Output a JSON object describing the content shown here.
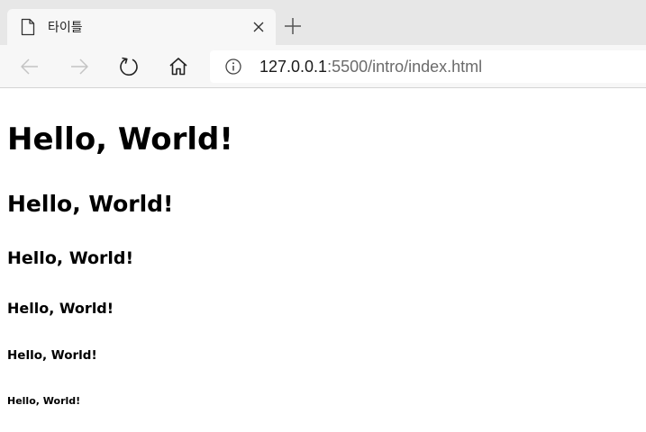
{
  "tab": {
    "title": "타이틀",
    "icon": "page-icon"
  },
  "toolbar": {
    "back_icon": "back-arrow-icon",
    "forward_icon": "forward-arrow-icon",
    "refresh_icon": "refresh-icon",
    "home_icon": "home-icon"
  },
  "address": {
    "host": "127.0.0.1",
    "rest": ":5500/intro/index.html",
    "icon": "info-icon"
  },
  "content": {
    "headings": [
      "Hello, World!",
      "Hello, World!",
      "Hello, World!",
      "Hello, World!",
      "Hello, World!",
      "Hello, World!"
    ]
  },
  "colors": {
    "tabstrip": "#e7e7e7",
    "toolbar": "#f7f7f7",
    "url_host": "#1a1a1a",
    "url_rest": "#6b6b6b",
    "disabled_icon": "#c4c4c4"
  }
}
